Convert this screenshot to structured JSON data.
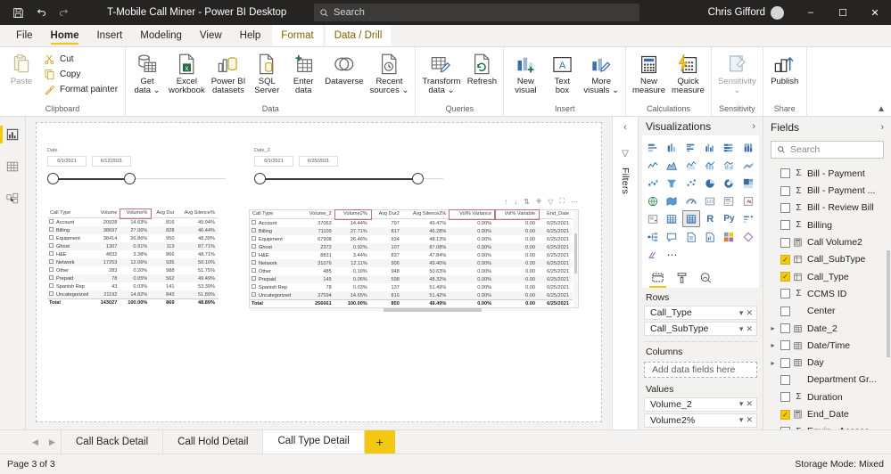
{
  "titlebar": {
    "save_icon": "save-icon",
    "undo_icon": "undo-icon",
    "redo_icon": "redo-icon",
    "title": "T-Mobile Call Miner - Power BI Desktop",
    "search_placeholder": "Search",
    "user_name": "Chris Gifford",
    "minimize": "–",
    "maximize": "☐",
    "close": "✕"
  },
  "menu": {
    "tabs": [
      {
        "label": "File",
        "state": "normal"
      },
      {
        "label": "Home",
        "state": "active"
      },
      {
        "label": "Insert",
        "state": "normal"
      },
      {
        "label": "Modeling",
        "state": "normal"
      },
      {
        "label": "View",
        "state": "normal"
      },
      {
        "label": "Help",
        "state": "normal"
      },
      {
        "label": "Format",
        "state": "contextual"
      },
      {
        "label": "Data / Drill",
        "state": "contextual"
      }
    ]
  },
  "ribbon": {
    "groups": [
      {
        "name": "Clipboard",
        "label": "Clipboard",
        "paste_label": "Paste",
        "items": [
          {
            "label": "Cut",
            "icon": "scissors-icon"
          },
          {
            "label": "Copy",
            "icon": "copy-icon"
          },
          {
            "label": "Format painter",
            "icon": "format-painter-icon"
          }
        ]
      },
      {
        "name": "Data",
        "label": "Data",
        "items": [
          {
            "label": "Get\ndata ⌄",
            "icon": "get-data-icon"
          },
          {
            "label": "Excel\nworkbook",
            "icon": "excel-workbook-icon"
          },
          {
            "label": "Power BI\ndatasets",
            "icon": "powerbi-datasets-icon"
          },
          {
            "label": "SQL\nServer",
            "icon": "sql-server-icon"
          },
          {
            "label": "Enter\ndata",
            "icon": "enter-data-icon"
          },
          {
            "label": "Dataverse",
            "icon": "dataverse-icon"
          },
          {
            "label": "Recent\nsources ⌄",
            "icon": "recent-sources-icon"
          }
        ]
      },
      {
        "name": "Queries",
        "label": "Queries",
        "items": [
          {
            "label": "Transform\ndata ⌄",
            "icon": "transform-data-icon"
          },
          {
            "label": "Refresh",
            "icon": "refresh-icon"
          }
        ]
      },
      {
        "name": "Insert",
        "label": "Insert",
        "items": [
          {
            "label": "New\nvisual",
            "icon": "new-visual-icon"
          },
          {
            "label": "Text\nbox",
            "icon": "text-box-icon"
          },
          {
            "label": "More\nvisuals ⌄",
            "icon": "more-visuals-icon"
          }
        ]
      },
      {
        "name": "Calculations",
        "label": "Calculations",
        "items": [
          {
            "label": "New\nmeasure",
            "icon": "new-measure-icon"
          },
          {
            "label": "Quick\nmeasure",
            "icon": "quick-measure-icon"
          }
        ]
      },
      {
        "name": "Sensitivity",
        "label": "Sensitivity",
        "items": [
          {
            "label": "Sensitivity\n⌄",
            "icon": "sensitivity-icon",
            "disabled": true
          }
        ]
      },
      {
        "name": "Share",
        "label": "Share",
        "items": [
          {
            "label": "Publish",
            "icon": "publish-icon"
          }
        ]
      }
    ],
    "collapse_icon": "chevron-up-icon"
  },
  "left_rail": {
    "items": [
      {
        "name": "report-view",
        "icon": "report-view-icon",
        "active": true
      },
      {
        "name": "data-view",
        "icon": "data-view-icon",
        "active": false
      },
      {
        "name": "model-view",
        "icon": "model-view-icon",
        "active": false
      }
    ]
  },
  "canvas": {
    "slicer_left": {
      "title": "Date",
      "from": "6/1/2021",
      "to": "6/12/2021",
      "fill_percent": 42
    },
    "slicer_right": {
      "title": "Date_2",
      "from": "6/1/2021",
      "to": "6/25/2021",
      "fill_percent": 99
    },
    "table_left": {
      "columns": [
        "Call Type",
        "Volume",
        "Volume%",
        "Avg Dur",
        "Avg Silence%"
      ],
      "highlight_column": "Volume%",
      "rows": [
        [
          "Account",
          "20928",
          "14.63%",
          "816",
          "49.94%"
        ],
        [
          "Billing",
          "38697",
          "27.06%",
          "828",
          "46.44%"
        ],
        [
          "Equipment",
          "38414",
          "26.86%",
          "950",
          "48.39%"
        ],
        [
          "Ghost",
          "1307",
          "0.91%",
          "113",
          "87.71%"
        ],
        [
          "H&E",
          "4832",
          "3.38%",
          "866",
          "48.71%"
        ],
        [
          "Network",
          "17253",
          "12.06%",
          "935",
          "50.10%"
        ],
        [
          "Other",
          "283",
          "0.20%",
          "988",
          "51.75%"
        ],
        [
          "Prepaid",
          "78",
          "0.05%",
          "562",
          "49.49%"
        ],
        [
          "Spanish Rep",
          "43",
          "0.03%",
          "141",
          "53.39%"
        ],
        [
          "Uncategorized",
          "21192",
          "14.82%",
          "843",
          "51.89%"
        ]
      ],
      "total": [
        "Total",
        "143027",
        "100.00%",
        "869",
        "48.89%"
      ]
    },
    "table_right": {
      "columns": [
        "Call Type",
        "Volume_2",
        "Volume2%",
        "Avg Dur2",
        "Avg Silence2%",
        "Vol% Variance",
        "Vol% Variable",
        "End_Date"
      ],
      "highlight_columns": [
        "Volume2%",
        "Vol% Variance",
        "Vol% Variable"
      ],
      "toolbar_icons": [
        "sort-asc-icon",
        "sort-down-icon",
        "sort-both-icon",
        "drill-down-icon",
        "filter-icon",
        "focus-mode-icon",
        "more-options-icon"
      ],
      "rows": [
        [
          "Account",
          "37063",
          "14.44%",
          "797",
          "49.47%",
          "0.00%",
          "0.00",
          "6/25/2021"
        ],
        [
          "Billing",
          "71109",
          "27.71%",
          "817",
          "46.28%",
          "0.00%",
          "0.00",
          "6/25/2021"
        ],
        [
          "Equipment",
          "67908",
          "26.46%",
          "934",
          "48.13%",
          "0.00%",
          "0.00",
          "6/25/2021"
        ],
        [
          "Ghost",
          "2372",
          "0.92%",
          "107",
          "87.08%",
          "0.00%",
          "0.00",
          "6/25/2021"
        ],
        [
          "H&E",
          "8831",
          "3.44%",
          "837",
          "47.84%",
          "0.00%",
          "0.00",
          "6/25/2021"
        ],
        [
          "Network",
          "31076",
          "12.11%",
          "906",
          "49.40%",
          "0.00%",
          "0.00",
          "6/25/2021"
        ],
        [
          "Other",
          "485",
          "0.19%",
          "948",
          "50.63%",
          "0.00%",
          "0.00",
          "6/25/2021"
        ],
        [
          "Prepaid",
          "145",
          "0.06%",
          "598",
          "48.32%",
          "0.00%",
          "0.00",
          "6/25/2021"
        ],
        [
          "Spanish Rep",
          "78",
          "0.03%",
          "137",
          "51.49%",
          "0.00%",
          "0.00",
          "6/25/2021"
        ],
        [
          "Uncategorized",
          "37594",
          "14.65%",
          "816",
          "51.42%",
          "0.00%",
          "0.00",
          "6/25/2021"
        ]
      ],
      "total": [
        "Total",
        "256661",
        "100.00%",
        "850",
        "48.49%",
        "0.00%",
        "0.00",
        "6/25/2021"
      ]
    }
  },
  "filters": {
    "collapse_icon": "chevron-left-icon",
    "filter_icon": "filter-icon",
    "label": "Filters"
  },
  "visualizations": {
    "title": "Visualizations",
    "expand_icon": "chevron-right-icon",
    "gallery": [
      "stacked-bar-chart-icon",
      "stacked-column-chart-icon",
      "clustered-bar-chart-icon",
      "clustered-column-chart-icon",
      "100-stacked-bar-chart-icon",
      "100-stacked-column-chart-icon",
      "line-chart-icon",
      "area-chart-icon",
      "stacked-area-chart-icon",
      "line-stacked-column-chart-icon",
      "line-clustered-column-chart-icon",
      "ribbon-chart-icon",
      "waterfall-chart-icon",
      "funnel-chart-icon",
      "scatter-chart-icon",
      "pie-chart-icon",
      "donut-chart-icon",
      "treemap-icon",
      "map-icon",
      "filled-map-icon",
      "gauge-icon",
      "card-icon",
      "multi-row-card-icon",
      "kpi-icon",
      "slicer-icon",
      "table-icon",
      "matrix-icon",
      "r-script-visual-icon",
      "python-visual-icon",
      "key-influencers-icon",
      "decomposition-tree-icon",
      "q-and-a-icon",
      "smart-narrative-icon",
      "paginated-report-icon",
      "power-apps-icon",
      "arcgis-maps-icon",
      "get-more-visuals-icon",
      "more-options-icon"
    ],
    "selected_gallery_index": 26,
    "tabs": [
      {
        "label": "fields-tab",
        "icon": "fields-tab-icon",
        "active": true
      },
      {
        "label": "format-tab",
        "icon": "paint-roller-icon",
        "active": false
      },
      {
        "label": "analytics-tab",
        "icon": "analytics-magnifier-icon",
        "active": false
      }
    ],
    "wells": [
      {
        "label": "Rows",
        "chips": [
          {
            "name": "Call_Type",
            "dropdown_icon": "chevron-down-icon",
            "remove_icon": "close-icon"
          },
          {
            "name": "Call_SubType",
            "dropdown_icon": "chevron-down-icon",
            "remove_icon": "close-icon"
          }
        ]
      },
      {
        "label": "Columns",
        "placeholder": "Add data fields here",
        "chips": []
      },
      {
        "label": "Values",
        "chips": [
          {
            "name": "Volume_2",
            "dropdown_icon": "chevron-down-icon",
            "remove_icon": "close-icon"
          },
          {
            "name": "Volume2%",
            "dropdown_icon": "chevron-down-icon",
            "remove_icon": "close-icon"
          }
        ]
      }
    ]
  },
  "fields": {
    "title": "Fields",
    "expand_icon": "chevron-right-icon",
    "search_placeholder": "Search",
    "search_icon": "search-icon",
    "items": [
      {
        "label": "Bill - Payment",
        "icon": "sigma-icon",
        "checked": false,
        "expandable": false
      },
      {
        "label": "Bill - Payment ...",
        "icon": "sigma-icon",
        "checked": false,
        "expandable": false
      },
      {
        "label": "Bill - Review Bill",
        "icon": "sigma-icon",
        "checked": false,
        "expandable": false
      },
      {
        "label": "Billing",
        "icon": "sigma-icon",
        "checked": false,
        "expandable": false
      },
      {
        "label": "Call Volume2",
        "icon": "calculator-icon",
        "checked": false,
        "expandable": false
      },
      {
        "label": "Call_SubType",
        "icon": "hierarchy-field-icon",
        "checked": true,
        "expandable": false
      },
      {
        "label": "Call_Type",
        "icon": "hierarchy-field-icon",
        "checked": true,
        "expandable": false
      },
      {
        "label": "CCMS ID",
        "icon": "sigma-icon",
        "checked": false,
        "expandable": false
      },
      {
        "label": "Center",
        "icon": "none",
        "checked": false,
        "expandable": false
      },
      {
        "label": "Date_2",
        "icon": "calendar-icon",
        "checked": false,
        "expandable": true
      },
      {
        "label": "Date/Time",
        "icon": "calendar-icon",
        "checked": false,
        "expandable": true
      },
      {
        "label": "Day",
        "icon": "calendar-icon",
        "checked": false,
        "expandable": true
      },
      {
        "label": "Department Gr...",
        "icon": "none",
        "checked": false,
        "expandable": false
      },
      {
        "label": "Duration",
        "icon": "sigma-icon",
        "checked": false,
        "expandable": false
      },
      {
        "label": "End_Date",
        "icon": "calculator-icon",
        "checked": true,
        "expandable": false
      },
      {
        "label": "Equip - Access...",
        "icon": "sigma-icon",
        "checked": false,
        "expandable": false
      }
    ]
  },
  "page_tabs": {
    "prev_icon": "chevron-left-icon",
    "next_icon": "chevron-right-icon",
    "tabs": [
      {
        "label": "Call Back Detail",
        "active": false
      },
      {
        "label": "Call Hold Detail",
        "active": false
      },
      {
        "label": "Call Type Detail",
        "active": true
      }
    ],
    "add_label": "+"
  },
  "statusbar": {
    "page_status": "Page 3 of 3",
    "storage_mode": "Storage Mode: Mixed"
  },
  "colors": {
    "accent_yellow": "#F2C811",
    "titlebar": "#252423",
    "app_bg": "#F3F2F1",
    "highlight_border": "#C0737A"
  }
}
